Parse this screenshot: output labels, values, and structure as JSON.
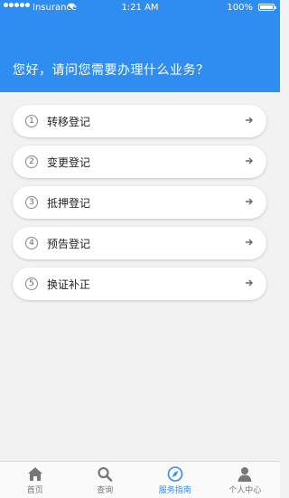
{
  "status_bar": {
    "carrier": "Insurance",
    "time": "1:21 AM",
    "battery": "100%"
  },
  "greeting": "您好，请问您需要办理什么业务？",
  "menu": [
    {
      "num": "1",
      "label": "转移登记"
    },
    {
      "num": "2",
      "label": "变更登记"
    },
    {
      "num": "3",
      "label": "抵押登记"
    },
    {
      "num": "4",
      "label": "预告登记"
    },
    {
      "num": "5",
      "label": "换证补正"
    }
  ],
  "tabs": [
    {
      "label": "首页",
      "icon": "home-icon"
    },
    {
      "label": "查询",
      "icon": "search-icon"
    },
    {
      "label": "服务指南",
      "icon": "compass-icon"
    },
    {
      "label": "个人中心",
      "icon": "user-icon"
    }
  ],
  "colors": {
    "accent": "#2f8cf0",
    "background": "#f2f2f2"
  }
}
